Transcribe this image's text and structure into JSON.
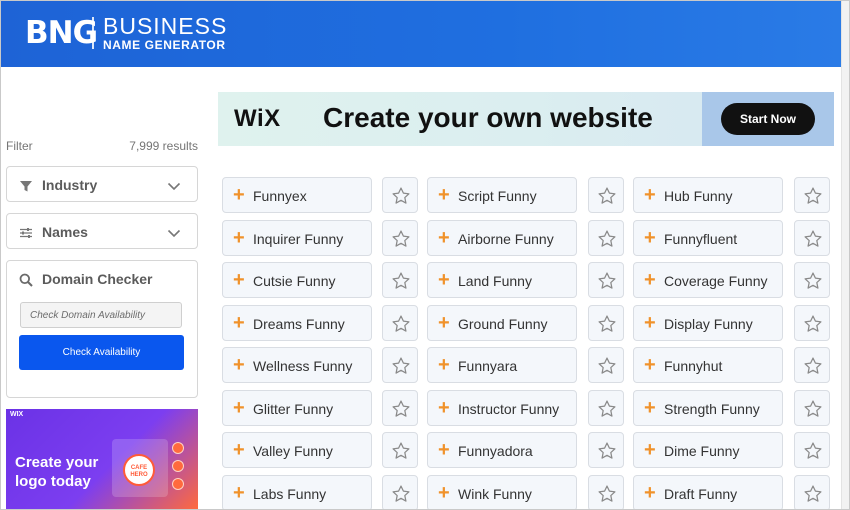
{
  "brand": {
    "mark": "BNG",
    "line1": "BUSINESS",
    "line2": "NAME GENERATOR",
    "header_color": "#1e63d6"
  },
  "sidebar": {
    "filter_label": "Filter",
    "results": "7,999 results",
    "industry_label": "Industry",
    "names_label": "Names",
    "domain_checker": {
      "title": "Domain Checker",
      "placeholder": "Check Domain Availability",
      "button": "Check Availability",
      "button_color": "#0a57ee"
    },
    "ad": {
      "brand": "WIX",
      "tagline_1": "Create your",
      "tagline_2": "logo today",
      "badge_line1": "CAFE",
      "badge_line2": "HERO"
    }
  },
  "banner": {
    "brand": "WiX",
    "headline": "Create your own  website",
    "cta": "Start Now"
  },
  "names": {
    "columns": [
      [
        "Funnyex",
        "Inquirer Funny",
        "Cutsie Funny",
        "Dreams Funny",
        "Wellness Funny",
        "Glitter Funny",
        "Valley Funny",
        "Labs Funny"
      ],
      [
        "Script Funny",
        "Airborne Funny",
        "Land Funny",
        "Ground Funny",
        "Funnyara",
        "Instructor Funny",
        "Funnyadora",
        "Wink Funny"
      ],
      [
        "Hub Funny",
        "Funnyfluent",
        "Coverage Funny",
        "Display Funny",
        "Funnyhut",
        "Strength Funny",
        "Dime Funny",
        "Draft Funny"
      ]
    ],
    "plus_glyph": "+",
    "plus_color": "#f0922b",
    "icons": [
      "plus-icon",
      "star-icon"
    ]
  }
}
